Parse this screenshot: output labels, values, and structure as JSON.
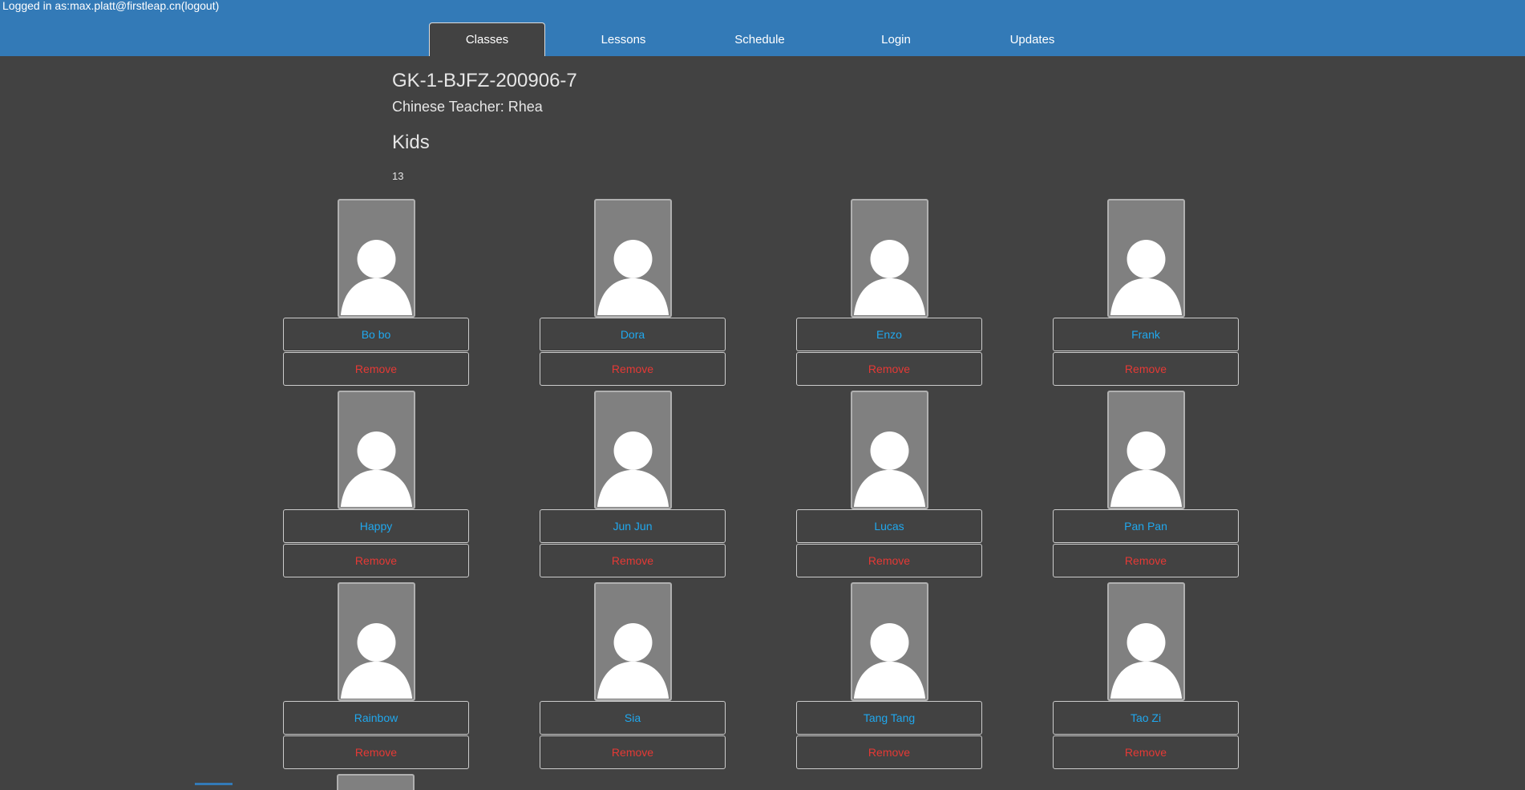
{
  "header": {
    "login_prefix": "Logged in as:",
    "user_email": "max.platt@firstleap.cn",
    "logout_label": "(logout)"
  },
  "nav": {
    "tabs": [
      {
        "label": "Classes",
        "active": true
      },
      {
        "label": "Lessons",
        "active": false
      },
      {
        "label": "Schedule",
        "active": false
      },
      {
        "label": "Login",
        "active": false
      },
      {
        "label": "Updates",
        "active": false
      }
    ]
  },
  "class_info": {
    "title": "GK-1-BJFZ-200906-7",
    "teacher_line": "Chinese Teacher: Rhea",
    "kids_heading": "Kids",
    "kids_count": "13"
  },
  "kids": [
    {
      "name": "Bo bo",
      "remove_label": "Remove"
    },
    {
      "name": "Dora",
      "remove_label": "Remove"
    },
    {
      "name": "Enzo",
      "remove_label": "Remove"
    },
    {
      "name": "Frank",
      "remove_label": "Remove"
    },
    {
      "name": "Happy",
      "remove_label": "Remove"
    },
    {
      "name": "Jun Jun",
      "remove_label": "Remove"
    },
    {
      "name": "Lucas",
      "remove_label": "Remove"
    },
    {
      "name": "Pan Pan",
      "remove_label": "Remove"
    },
    {
      "name": "Rainbow",
      "remove_label": "Remove"
    },
    {
      "name": "Sia",
      "remove_label": "Remove"
    },
    {
      "name": "Tang Tang",
      "remove_label": "Remove"
    },
    {
      "name": "Tao Zi",
      "remove_label": "Remove"
    }
  ],
  "icons": {
    "avatar": "user-silhouette-icon"
  },
  "colors": {
    "topbar": "#337ab7",
    "background": "#424242",
    "name_link": "#20a8ee",
    "remove_link": "#e53935"
  }
}
